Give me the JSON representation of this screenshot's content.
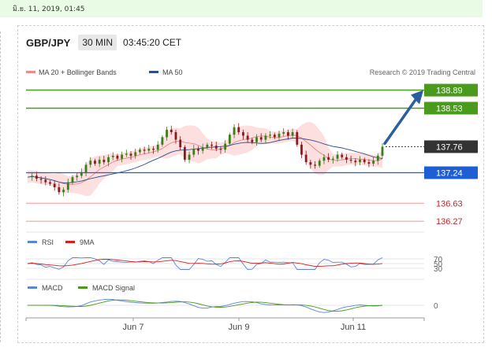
{
  "date_bar": "มิ.ย. 11, 2019, 01:45",
  "header": {
    "pair": "GBP/JPY",
    "timeframe": "30 MIN",
    "time": "03:45:20 CET"
  },
  "legend": {
    "bb": "MA 20 + Bollinger Bands",
    "ma50": "MA 50",
    "credit": "Research © 2019 Trading Central"
  },
  "rsi_legend": {
    "rsi": "RSI",
    "ma": "9MA"
  },
  "macd_legend": {
    "macd": "MACD",
    "signal": "MACD Signal"
  },
  "colors": {
    "up": "#3a7d1a",
    "down": "#8b1a1a",
    "green_level": "#4a9a1e",
    "blue_level": "#1f5fd6",
    "red_level": "#c0282b",
    "price": "#333333",
    "arrow": "#2a5e9e",
    "bb_fill": "#fdd9d9",
    "ma50": "#2e4e8f"
  },
  "chart_data": {
    "type": "candlestick",
    "x_ticks": [
      "Jun 7",
      "Jun 9",
      "Jun 11"
    ],
    "levels": [
      {
        "label": "138.89",
        "kind": "resistance"
      },
      {
        "label": "138.53",
        "kind": "resistance"
      },
      {
        "label": "137.76",
        "kind": "current"
      },
      {
        "label": "137.24",
        "kind": "support"
      },
      {
        "label": "136.63",
        "kind": "support"
      },
      {
        "label": "136.27",
        "kind": "support"
      }
    ],
    "price_range": [
      136.0,
      139.2
    ],
    "target": 138.89,
    "current": 137.76,
    "close_path": [
      137.15,
      137.18,
      137.12,
      137.1,
      137.05,
      137.02,
      136.95,
      136.85,
      136.9,
      137.05,
      137.15,
      137.18,
      137.25,
      137.4,
      137.48,
      137.42,
      137.5,
      137.45,
      137.55,
      137.58,
      137.52,
      137.6,
      137.62,
      137.58,
      137.65,
      137.7,
      137.68,
      137.72,
      137.7,
      137.8,
      137.95,
      138.1,
      138.05,
      137.9,
      137.75,
      137.5,
      137.6,
      137.72,
      137.68,
      137.75,
      137.8,
      137.78,
      137.72,
      137.7,
      137.82,
      138.0,
      138.15,
      138.05,
      137.98,
      137.9,
      137.85,
      137.95,
      137.9,
      137.98,
      138.0,
      137.95,
      138.02,
      138.05,
      137.98,
      138.05,
      137.8,
      137.6,
      137.45,
      137.4,
      137.38,
      137.48,
      137.55,
      137.5,
      137.52,
      137.6,
      137.55,
      137.5,
      137.48,
      137.45,
      137.5,
      137.45,
      137.42,
      137.48,
      137.58,
      137.76
    ],
    "rsi": {
      "levels": [
        70,
        50,
        30
      ]
    },
    "macd": {
      "zero": 0
    }
  }
}
